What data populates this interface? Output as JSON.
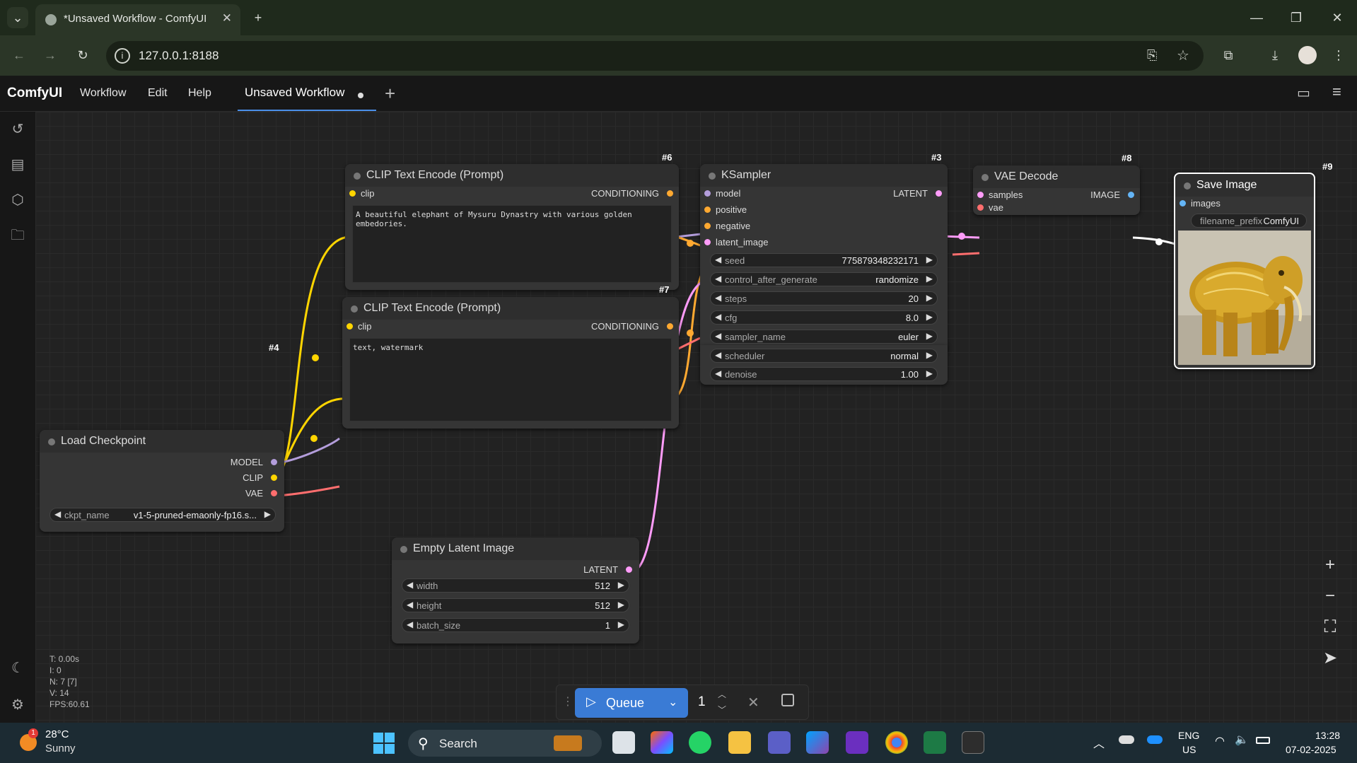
{
  "browser": {
    "tab_title": "*Unsaved Workflow - ComfyUI",
    "url": "127.0.0.1:8188"
  },
  "menubar": {
    "brand": "ComfyUI",
    "items": [
      "Workflow",
      "Edit",
      "Help"
    ],
    "workflow_tab": "Unsaved Workflow"
  },
  "nodes": {
    "clip6": {
      "id": "#6",
      "title": "CLIP Text Encode (Prompt)",
      "input": "clip",
      "output": "CONDITIONING",
      "text": "A beautiful elephant of Mysuru Dynastry with various golden embedories."
    },
    "clip7": {
      "id": "#7",
      "title": "CLIP Text Encode (Prompt)",
      "input": "clip",
      "output": "CONDITIONING",
      "text": "text, watermark"
    },
    "ksampler": {
      "id": "#3",
      "title": "KSampler",
      "inputs": [
        "model",
        "positive",
        "negative",
        "latent_image"
      ],
      "output": "LATENT",
      "widgets": [
        {
          "name": "seed",
          "value": "775879348232171"
        },
        {
          "name": "control_after_generate",
          "value": "randomize"
        },
        {
          "name": "steps",
          "value": "20"
        },
        {
          "name": "cfg",
          "value": "8.0"
        },
        {
          "name": "sampler_name",
          "value": "euler"
        },
        {
          "name": "scheduler",
          "value": "normal"
        },
        {
          "name": "denoise",
          "value": "1.00"
        }
      ]
    },
    "vae": {
      "id": "#8",
      "title": "VAE Decode",
      "inputs": [
        "samples",
        "vae"
      ],
      "output": "IMAGE"
    },
    "save": {
      "id": "#9",
      "title": "Save Image",
      "input": "images",
      "widget_name": "filename_prefix",
      "widget_value": "ComfyUI"
    },
    "checkpoint": {
      "id": "#4",
      "title": "Load Checkpoint",
      "outputs": [
        "MODEL",
        "CLIP",
        "VAE"
      ],
      "widget_name": "ckpt_name",
      "widget_value": "v1-5-pruned-emaonly-fp16.s..."
    },
    "latent": {
      "title": "Empty Latent Image",
      "output": "LATENT",
      "widgets": [
        {
          "name": "width",
          "value": "512"
        },
        {
          "name": "height",
          "value": "512"
        },
        {
          "name": "batch_size",
          "value": "1"
        }
      ]
    }
  },
  "stats": {
    "t": "T: 0.00s",
    "i": "I: 0",
    "n": "N: 7 [7]",
    "v": "V: 14",
    "fps": "FPS:60.61"
  },
  "queue": {
    "label": "Queue",
    "count": "1"
  },
  "taskbar": {
    "temp": "28°C",
    "weather": "Sunny",
    "search": "Search",
    "lang1": "ENG",
    "lang2": "US",
    "time": "13:28",
    "date": "07-02-2025"
  },
  "colors": {
    "accent": "#3a7bd5",
    "wire_clip": "#ffd500",
    "wire_model": "#b39ddb",
    "wire_vae": "#ff6e6e",
    "wire_latent": "#ff9cf9",
    "wire_cond": "#ffa931"
  }
}
